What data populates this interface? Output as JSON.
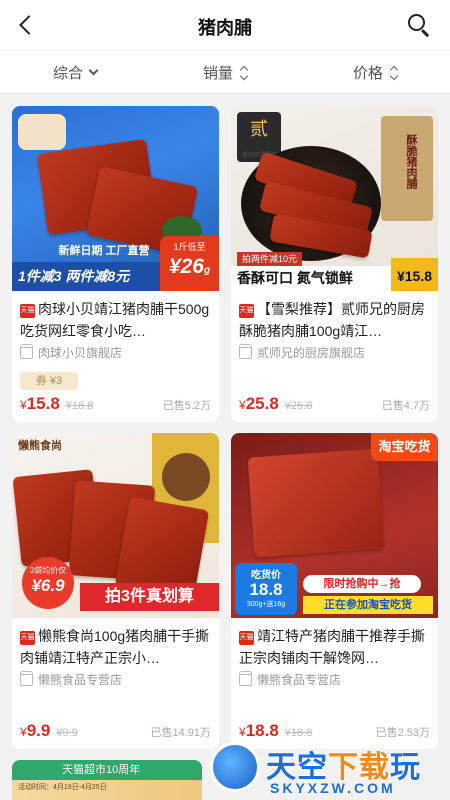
{
  "header": {
    "title": "猪肉脯"
  },
  "sort": {
    "comprehensive": "综合",
    "sales": "销量",
    "price": "价格"
  },
  "products": [
    {
      "title": "肉球小贝靖江猪肉脯干500g吃货网红零食小吃…",
      "shop": "肉球小贝旗舰店",
      "coupon": "券 ¥3",
      "currency": "¥",
      "price": "15.8",
      "original": "¥18.8",
      "sold": "已售5.2万",
      "img_banner_top": "新鲜日期 工厂直营",
      "img_banner_bottom": "1件减3 两件减8元",
      "img_price_tag": "1斤低至",
      "img_price": "¥26",
      "img_price_unit": "g"
    },
    {
      "title": "【雪梨推荐】贰师兄的厨房酥脆猪肉脯100g靖江…",
      "shop": "贰师兄的厨房旗舰店",
      "currency": "¥",
      "price": "25.8",
      "original": "¥25.8",
      "sold": "已售4.7万",
      "img_promo": "拍两件减10元",
      "img_slogan": "香酥可口 氮气锁鲜",
      "img_price": "¥15.8",
      "img_brand": "贰师兄的厨房",
      "img_package_text": "酥脆猪肉脯"
    },
    {
      "title": "懒熊食尚100g猪肉脯干手撕肉铺靖江特产正宗小…",
      "shop": "懒熊食品专营店",
      "currency": "¥",
      "price": "9.9",
      "original": "¥9.9",
      "sold": "已售14.91万",
      "img_tag": "3袋均价仅",
      "img_price": "¥6.9",
      "img_banner": "拍3件真划算",
      "img_brand": "懒熊食尚"
    },
    {
      "title": "靖江特产猪肉脯干推荐手撕正宗肉铺肉干解馋网…",
      "shop": "懒熊食品专营店",
      "currency": "¥",
      "price": "18.8",
      "original": "¥18.8",
      "sold": "已售2.53万",
      "img_tag": "淘宝吃货",
      "img_flash": "限时抢购中→抢",
      "img_event": "正在参加淘宝吃货",
      "img_price_label": "吃货价",
      "img_price": "18.8",
      "img_weight": "300g+送16g"
    }
  ],
  "partial_card": {
    "banner": "天猫超市10周年",
    "date": "活动时间：4月19日-4月25日"
  },
  "tmall_badge": "天猫",
  "watermark": {
    "name_blue": "天空",
    "name_orange": "下载",
    "name_end": "玩",
    "url": "SKYXZW.COM"
  }
}
